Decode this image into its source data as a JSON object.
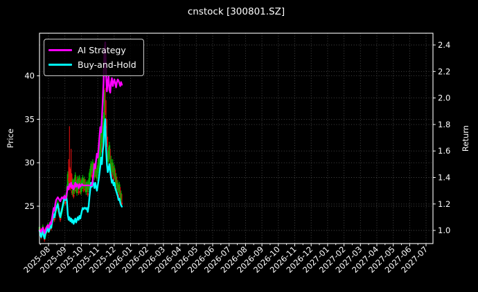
{
  "title": "cnstock [300801.SZ]",
  "legend": {
    "items": [
      {
        "label": "AI Strategy",
        "color": "#ff00ff"
      },
      {
        "label": "Buy-and-Hold",
        "color": "#00ffff"
      }
    ]
  },
  "chart_data": {
    "type": "line",
    "title": "cnstock [300801.SZ]",
    "background": "#000000",
    "text_color": "#ffffff",
    "grid": {
      "color": "#4d4d4d",
      "style": "dotted"
    },
    "legend_position": "upper left",
    "left_axis": {
      "label": "Price",
      "ticks": [
        25,
        30,
        35,
        40
      ],
      "tick_labels": [
        "25",
        "30",
        "35",
        "40"
      ],
      "range": [
        20.7,
        44.9
      ]
    },
    "right_axis": {
      "label": "Return",
      "ticks": [
        1.0,
        1.2,
        1.4,
        1.6,
        1.8,
        2.0,
        2.2,
        2.4
      ],
      "tick_labels": [
        "1.0",
        "1.2",
        "1.4",
        "1.6",
        "1.8",
        "2.0",
        "2.2",
        "2.4"
      ],
      "range": [
        0.901,
        2.489
      ]
    },
    "x_axis": {
      "tick_labels": [
        "2025-08",
        "2025-09",
        "2025-10",
        "2025-11",
        "2025-12",
        "2026-01",
        "2026-02",
        "2026-03",
        "2026-04",
        "2026-05",
        "2026-06",
        "2026-07",
        "2026-08",
        "2026-09",
        "2026-10",
        "2026-11",
        "2026-12",
        "2027-01",
        "2027-02",
        "2027-03",
        "2027-04",
        "2027-05",
        "2027-06",
        "2027-07"
      ],
      "range_months": [
        -0.55,
        23.42
      ],
      "minor_ticks_every": 0.5
    },
    "days": {
      "count": 100,
      "month_start": -0.549,
      "month_step": 0.0507
    },
    "series": [
      {
        "name": "AI Strategy",
        "color": "#ff00ff",
        "axis": "return",
        "line_width": 2.4,
        "values": [
          1.0,
          1.0,
          0.99,
          1.01,
          1.02,
          1.0,
          0.98,
          1.0,
          1.02,
          1.03,
          1.04,
          1.02,
          1.04,
          1.06,
          1.05,
          1.09,
          1.13,
          1.17,
          1.15,
          1.2,
          1.23,
          1.24,
          1.25,
          1.24,
          1.23,
          1.22,
          1.24,
          1.25,
          1.24,
          1.25,
          1.26,
          1.24,
          1.25,
          1.29,
          1.33,
          1.31,
          1.35,
          1.33,
          1.36,
          1.32,
          1.34,
          1.31,
          1.33,
          1.36,
          1.33,
          1.35,
          1.34,
          1.32,
          1.35,
          1.33,
          1.34,
          1.35,
          1.34,
          1.34,
          1.34,
          1.34,
          1.34,
          1.34,
          1.34,
          1.34,
          1.34,
          1.34,
          1.34,
          1.34,
          1.38,
          1.44,
          1.5,
          1.47,
          1.53,
          1.58,
          1.55,
          1.62,
          1.7,
          1.78,
          1.74,
          1.85,
          1.98,
          2.12,
          2.35,
          2.42,
          2.18,
          2.05,
          2.12,
          2.16,
          2.06,
          2.04,
          2.12,
          2.15,
          2.09,
          2.12,
          2.14,
          2.11,
          2.08,
          2.12,
          2.14,
          2.13,
          2.11,
          2.09,
          2.12,
          2.1
        ]
      },
      {
        "name": "Buy-and-Hold",
        "color": "#00ffff",
        "axis": "return",
        "line_width": 2.4,
        "values": [
          1.0,
          0.97,
          0.95,
          0.98,
          1.0,
          0.96,
          0.94,
          0.97,
          0.99,
          1.0,
          1.02,
          0.99,
          1.01,
          1.03,
          1.02,
          1.06,
          1.09,
          1.12,
          1.1,
          1.14,
          1.17,
          1.18,
          1.2,
          1.16,
          1.12,
          1.1,
          1.13,
          1.16,
          1.19,
          1.22,
          1.25,
          1.23,
          1.26,
          1.22,
          1.12,
          1.08,
          1.1,
          1.07,
          1.09,
          1.06,
          1.08,
          1.05,
          1.07,
          1.09,
          1.06,
          1.08,
          1.1,
          1.08,
          1.11,
          1.09,
          1.12,
          1.15,
          1.17,
          1.16,
          1.17,
          1.17,
          1.16,
          1.17,
          1.14,
          1.18,
          1.25,
          1.31,
          1.36,
          1.33,
          1.37,
          1.35,
          1.32,
          1.36,
          1.33,
          1.3,
          1.34,
          1.38,
          1.43,
          1.48,
          1.55,
          1.5,
          1.6,
          1.65,
          1.78,
          1.84,
          1.62,
          1.5,
          1.44,
          1.47,
          1.5,
          1.44,
          1.4,
          1.36,
          1.38,
          1.34,
          1.36,
          1.32,
          1.3,
          1.28,
          1.26,
          1.23,
          1.24,
          1.21,
          1.19,
          1.18
        ]
      }
    ],
    "candles": {
      "up_color": "#00b000",
      "down_color": "#e01010",
      "format": [
        "high",
        "low",
        "body_top",
        "body_bottom",
        "dir"
      ],
      "days": [
        [
          22.8,
          21.9,
          22.6,
          22.1,
          "g"
        ],
        [
          22.5,
          21.6,
          22.4,
          21.8,
          "r"
        ],
        [
          22.2,
          21.2,
          22.0,
          21.4,
          "r"
        ],
        [
          22.4,
          21.5,
          22.2,
          21.7,
          "g"
        ],
        [
          22.9,
          21.9,
          22.7,
          22.2,
          "g"
        ],
        [
          22.6,
          21.3,
          22.4,
          21.5,
          "r"
        ],
        [
          21.9,
          20.9,
          21.7,
          21.1,
          "r"
        ],
        [
          22.3,
          21.2,
          22.1,
          21.5,
          "g"
        ],
        [
          22.6,
          21.8,
          22.4,
          22.0,
          "g"
        ],
        [
          22.8,
          21.9,
          22.6,
          22.2,
          "g"
        ],
        [
          23.1,
          22.2,
          22.9,
          22.4,
          "g"
        ],
        [
          22.8,
          21.9,
          22.2,
          22.0,
          "r"
        ],
        [
          22.9,
          22.0,
          22.7,
          22.2,
          "g"
        ],
        [
          23.3,
          22.4,
          23.1,
          22.6,
          "g"
        ],
        [
          23.0,
          22.2,
          22.6,
          22.4,
          "r"
        ],
        [
          23.6,
          22.5,
          23.4,
          22.8,
          "g"
        ],
        [
          24.0,
          23.1,
          23.8,
          23.3,
          "g"
        ],
        [
          24.4,
          23.5,
          24.2,
          23.7,
          "g"
        ],
        [
          24.1,
          23.2,
          23.6,
          23.4,
          "r"
        ],
        [
          24.7,
          23.6,
          24.5,
          23.9,
          "g"
        ],
        [
          25.2,
          24.2,
          25.0,
          24.5,
          "g"
        ],
        [
          25.4,
          24.4,
          25.2,
          24.7,
          "g"
        ],
        [
          25.7,
          24.8,
          25.5,
          25.0,
          "g"
        ],
        [
          25.3,
          24.1,
          24.5,
          24.3,
          "r"
        ],
        [
          24.8,
          23.6,
          24.0,
          23.8,
          "r"
        ],
        [
          24.3,
          23.2,
          23.6,
          23.4,
          "r"
        ],
        [
          24.6,
          23.6,
          24.4,
          23.9,
          "g"
        ],
        [
          25.0,
          24.1,
          24.8,
          24.3,
          "g"
        ],
        [
          25.5,
          24.5,
          25.3,
          24.8,
          "g"
        ],
        [
          25.9,
          25.0,
          25.7,
          25.2,
          "g"
        ],
        [
          26.4,
          25.4,
          26.2,
          25.7,
          "g"
        ],
        [
          26.1,
          25.1,
          25.5,
          25.3,
          "r"
        ],
        [
          26.6,
          25.6,
          26.4,
          25.9,
          "g"
        ],
        [
          27.5,
          25.8,
          27.3,
          26.1,
          "g"
        ],
        [
          29.0,
          26.8,
          28.7,
          27.1,
          "g"
        ],
        [
          30.4,
          27.8,
          28.2,
          28.0,
          "r"
        ],
        [
          34.2,
          26.9,
          29.5,
          27.2,
          "r"
        ],
        [
          29.3,
          26.8,
          27.3,
          27.0,
          "r"
        ],
        [
          31.6,
          27.0,
          28.8,
          27.3,
          "r"
        ],
        [
          28.7,
          26.3,
          26.8,
          26.5,
          "r"
        ],
        [
          28.2,
          26.1,
          28.0,
          26.4,
          "g"
        ],
        [
          27.7,
          25.9,
          26.3,
          26.1,
          "r"
        ],
        [
          28.3,
          26.4,
          28.1,
          26.7,
          "g"
        ],
        [
          28.9,
          27.0,
          28.6,
          27.3,
          "g"
        ],
        [
          28.4,
          26.5,
          26.9,
          26.7,
          "r"
        ],
        [
          28.0,
          26.2,
          27.8,
          26.5,
          "g"
        ],
        [
          28.5,
          26.8,
          28.2,
          27.1,
          "g"
        ],
        [
          28.1,
          26.3,
          26.7,
          26.5,
          "r"
        ],
        [
          28.6,
          26.9,
          28.4,
          27.2,
          "g"
        ],
        [
          28.2,
          26.4,
          26.8,
          26.6,
          "r"
        ],
        [
          28.0,
          26.3,
          27.8,
          26.6,
          "g"
        ],
        [
          28.3,
          26.7,
          28.1,
          27.0,
          "g"
        ],
        [
          28.6,
          27.0,
          28.3,
          27.3,
          "g"
        ],
        [
          28.2,
          26.6,
          26.9,
          26.8,
          "r"
        ],
        [
          28.4,
          26.9,
          28.1,
          27.2,
          "g"
        ],
        [
          28.1,
          26.6,
          27.0,
          26.8,
          "r"
        ],
        [
          27.8,
          26.3,
          27.6,
          26.6,
          "g"
        ],
        [
          28.0,
          26.6,
          27.8,
          26.9,
          "g"
        ],
        [
          27.6,
          26.1,
          26.5,
          26.3,
          "r"
        ],
        [
          28.2,
          26.6,
          28.0,
          26.9,
          "g"
        ],
        [
          29.0,
          27.2,
          28.8,
          27.5,
          "g"
        ],
        [
          29.6,
          28.0,
          29.3,
          28.3,
          "g"
        ],
        [
          30.2,
          28.5,
          29.9,
          28.8,
          "g"
        ],
        [
          29.8,
          28.2,
          28.6,
          28.4,
          "r"
        ],
        [
          30.4,
          28.7,
          30.1,
          29.0,
          "g"
        ],
        [
          30.0,
          28.4,
          28.8,
          28.6,
          "r"
        ],
        [
          29.6,
          28.0,
          29.3,
          28.3,
          "g"
        ],
        [
          30.2,
          28.6,
          29.9,
          28.9,
          "g"
        ],
        [
          29.8,
          28.2,
          28.6,
          28.4,
          "r"
        ],
        [
          29.4,
          27.9,
          29.1,
          28.2,
          "g"
        ],
        [
          30.0,
          28.5,
          29.7,
          28.8,
          "g"
        ],
        [
          30.8,
          29.0,
          30.5,
          29.3,
          "g"
        ],
        [
          31.6,
          29.8,
          31.3,
          30.1,
          "g"
        ],
        [
          32.5,
          30.5,
          32.2,
          30.8,
          "g"
        ],
        [
          33.8,
          31.5,
          33.4,
          31.8,
          "g"
        ],
        [
          33.2,
          31.0,
          31.5,
          31.2,
          "r"
        ],
        [
          34.6,
          32.0,
          34.2,
          32.3,
          "g"
        ],
        [
          35.8,
          33.2,
          35.4,
          33.5,
          "g"
        ],
        [
          38.4,
          33.8,
          38.1,
          34.2,
          "g"
        ],
        [
          38.6,
          35.5,
          36.0,
          35.8,
          "r"
        ],
        [
          37.2,
          33.8,
          34.2,
          34.0,
          "r"
        ],
        [
          35.0,
          31.8,
          32.2,
          32.0,
          "r"
        ],
        [
          33.0,
          30.2,
          30.6,
          30.4,
          "r"
        ],
        [
          31.8,
          29.8,
          31.4,
          30.1,
          "g"
        ],
        [
          32.4,
          30.4,
          32.0,
          30.7,
          "g"
        ],
        [
          31.6,
          29.4,
          29.8,
          29.6,
          "r"
        ],
        [
          30.8,
          28.8,
          30.4,
          29.1,
          "g"
        ],
        [
          30.0,
          28.2,
          28.6,
          28.4,
          "r"
        ],
        [
          30.4,
          28.6,
          30.0,
          28.9,
          "g"
        ],
        [
          29.6,
          27.9,
          28.2,
          28.0,
          "r"
        ],
        [
          29.8,
          28.1,
          29.4,
          28.4,
          "g"
        ],
        [
          29.2,
          27.5,
          27.8,
          27.6,
          "r"
        ],
        [
          28.8,
          27.2,
          28.4,
          27.5,
          "g"
        ],
        [
          28.4,
          26.8,
          27.1,
          26.9,
          "r"
        ],
        [
          28.0,
          26.5,
          27.7,
          26.8,
          "g"
        ],
        [
          27.5,
          26.0,
          26.3,
          26.1,
          "r"
        ],
        [
          27.8,
          26.3,
          27.5,
          26.6,
          "g"
        ],
        [
          27.2,
          25.8,
          26.1,
          25.9,
          "r"
        ],
        [
          26.8,
          25.4,
          26.5,
          25.7,
          "g"
        ],
        [
          26.4,
          25.1,
          25.4,
          25.2,
          "r"
        ]
      ]
    }
  }
}
